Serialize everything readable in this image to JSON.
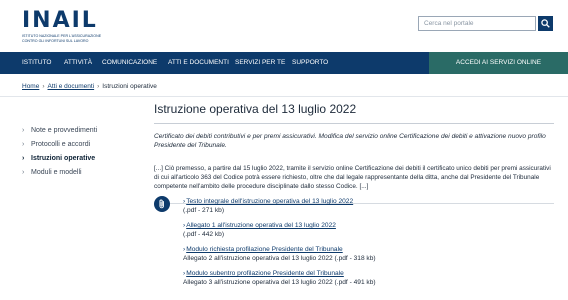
{
  "header": {
    "logo_text": "INAIL",
    "logo_subtitle": "Istituto nazionale per l'assicurazione contro gli infortuni sul lavoro",
    "search_placeholder": "Cerca nel portale"
  },
  "nav": {
    "items": [
      "Istituto",
      "Attività",
      "Comunicazione",
      "Atti e documenti",
      "Servizi per te",
      "Supporto"
    ],
    "services_button": "Accedi ai servizi online"
  },
  "breadcrumb": {
    "items": [
      "Home",
      "Atti e documenti",
      "Istruzioni operative"
    ]
  },
  "sidebar": {
    "items": [
      {
        "label": "Note e provvedimenti",
        "active": false
      },
      {
        "label": "Protocolli e accordi",
        "active": false
      },
      {
        "label": "Istruzioni operative",
        "active": true
      },
      {
        "label": "Moduli e modelli",
        "active": false
      }
    ]
  },
  "main": {
    "title": "Istruzione operativa del 13 luglio 2022",
    "lead": "Certificato dei debiti contributivi e per premi assicurativi. Modifica del servizio online Certificazione dei debiti e attivazione nuovo profilo Presidente del Tribunale.",
    "body": "[...] Ciò premesso, a partire dal 15 luglio 2022, tramite il servizio online Certificazione dei debiti il certificato unico debiti per premi assicurativi di cui all'articolo 363 del Codice potrà essere richiesto, oltre che dal legale rappresentante della ditta, anche dal Presidente del Tribunale competente nell'ambito delle procedure disciplinate dallo stesso Codice. [...]"
  },
  "attachments": [
    {
      "link": "Testo integrale dell'istruzione operativa del 13 luglio 2022",
      "desc": "(.pdf - 271 kb)"
    },
    {
      "link": "Allegato 1 all'istruzione operativa del 13 luglio 2022",
      "desc": "(.pdf - 442 kb)"
    },
    {
      "link": "Modulo richiesta profilazione Presidente del Tribunale",
      "desc": "Allegato 2 all'istruzione operativa del 13 luglio 2022 (.pdf - 318 kb)"
    },
    {
      "link": "Modulo subentro profilazione Presidente del Tribunale",
      "desc": "Allegato 3 all'istruzione operativa del 13 luglio 2022 (.pdf - 491 kb)"
    }
  ],
  "colors": {
    "brand_navy": "#0d3a6b",
    "services_teal": "#2a6b66"
  }
}
